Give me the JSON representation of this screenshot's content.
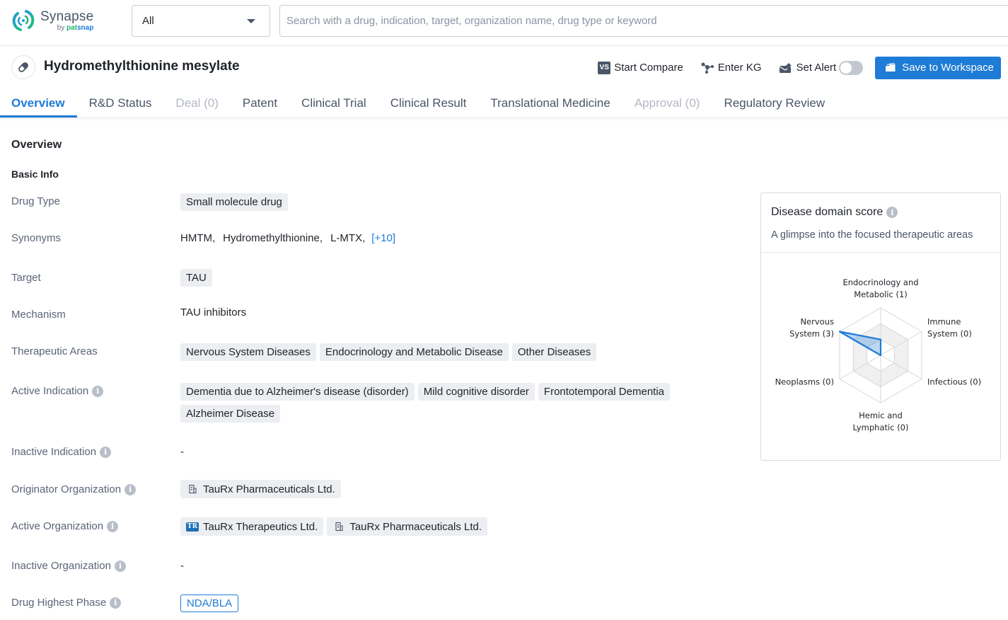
{
  "app": {
    "name": "Synapse",
    "by": "by",
    "brand_a": "pat",
    "brand_b": "snap"
  },
  "search": {
    "scope_value": "All",
    "placeholder": "Search with a drug, indication, target, organization name, drug type or keyword",
    "value": ""
  },
  "header": {
    "title": "Hydromethylthionine mesylate",
    "actions": {
      "compare_badge": "VS",
      "compare": "Start Compare",
      "kg": "Enter KG",
      "alert": "Set Alert",
      "alert_enabled": false,
      "save": "Save to Workspace"
    }
  },
  "tabs": [
    {
      "label": "Overview",
      "state": "active"
    },
    {
      "label": "R&D Status",
      "state": "normal"
    },
    {
      "label": "Deal (0)",
      "state": "disabled"
    },
    {
      "label": "Patent",
      "state": "normal"
    },
    {
      "label": "Clinical Trial",
      "state": "normal"
    },
    {
      "label": "Clinical Result",
      "state": "normal"
    },
    {
      "label": "Translational Medicine",
      "state": "normal"
    },
    {
      "label": "Approval (0)",
      "state": "disabled"
    },
    {
      "label": "Regulatory Review",
      "state": "normal"
    }
  ],
  "overview": {
    "section_title": "Overview",
    "sub_title": "Basic Info",
    "info_glyph": "i",
    "fields": {
      "drug_type": {
        "label": "Drug Type",
        "chips": [
          "Small molecule drug"
        ]
      },
      "synonyms": {
        "label": "Synonyms",
        "values": [
          "HMTM,",
          "Hydromethylthionine,",
          "L-MTX,"
        ],
        "more": "[+10]"
      },
      "target": {
        "label": "Target",
        "chips": [
          "TAU"
        ]
      },
      "mechanism": {
        "label": "Mechanism",
        "value": "TAU inhibitors"
      },
      "therapeutic_areas": {
        "label": "Therapeutic Areas",
        "chips": [
          "Nervous System Diseases",
          "Endocrinology and Metabolic Disease",
          "Other Diseases"
        ]
      },
      "active_indication": {
        "label": "Active Indication",
        "chips": [
          "Dementia due to Alzheimer's disease (disorder)",
          "Mild cognitive disorder",
          "Frontotemporal Dementia",
          "Alzheimer Disease"
        ]
      },
      "inactive_indication": {
        "label": "Inactive Indication",
        "value": "-"
      },
      "originator_org": {
        "label": "Originator Organization",
        "orgs": [
          {
            "name": "TauRx Pharmaceuticals Ltd.",
            "icon": "building-icon"
          }
        ]
      },
      "active_org": {
        "label": "Active Organization",
        "orgs": [
          {
            "name": "TauRx Therapeutics Ltd.",
            "icon": "tr-logo-icon",
            "logo_text": "TR"
          },
          {
            "name": "TauRx Pharmaceuticals Ltd.",
            "icon": "building-icon"
          }
        ]
      },
      "inactive_org": {
        "label": "Inactive Organization",
        "value": "-"
      },
      "highest_phase": {
        "label": "Drug Highest Phase",
        "value": "NDA/BLA"
      }
    }
  },
  "domain_card": {
    "title": "Disease domain score",
    "subtitle": "A glimpse into the focused therapeutic areas"
  },
  "chart_data": {
    "type": "radar",
    "title": "Disease domain score",
    "max": 3,
    "levels": 3,
    "axes": [
      {
        "name": "Endocrinology and Metabolic",
        "lines": [
          "Endocrinology and",
          "Metabolic (1)"
        ],
        "value": 1
      },
      {
        "name": "Immune System",
        "lines": [
          "Immune",
          "System (0)"
        ],
        "value": 0
      },
      {
        "name": "Infectious",
        "lines": [
          "Infectious (0)"
        ],
        "value": 0
      },
      {
        "name": "Hemic and Lymphatic",
        "lines": [
          "Hemic and",
          "Lymphatic (0)"
        ],
        "value": 0
      },
      {
        "name": "Neoplasms",
        "lines": [
          "Neoplasms (0)"
        ],
        "value": 0
      },
      {
        "name": "Nervous System",
        "lines": [
          "Nervous",
          "System (3)"
        ],
        "value": 3
      }
    ],
    "series_color": "#1e7bd6"
  }
}
